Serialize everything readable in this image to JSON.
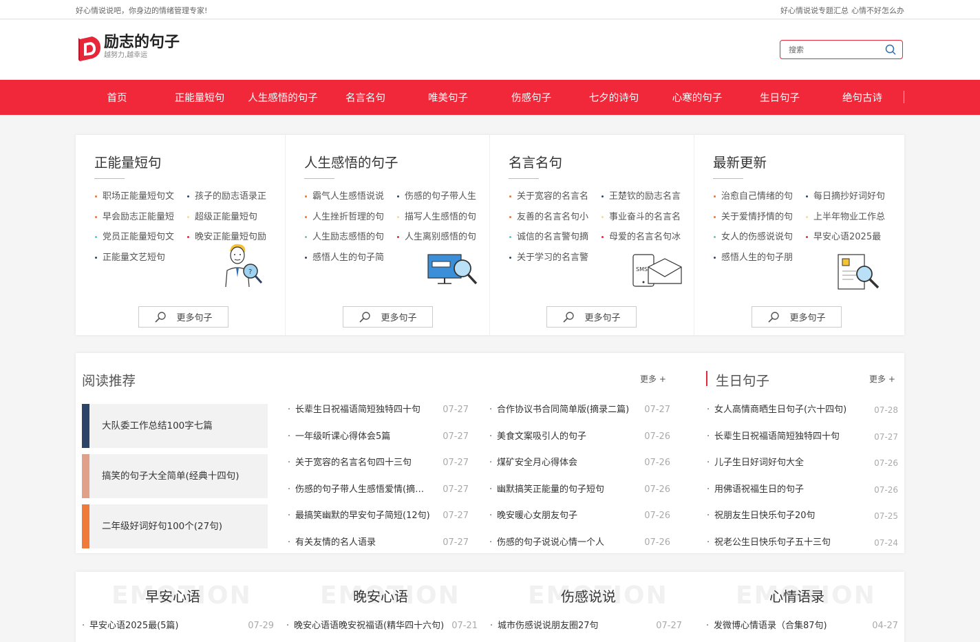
{
  "topbar": {
    "left": "好心情说说吧，你身边的情绪管理专家!",
    "right_links": [
      "好心情说说专题汇总",
      "心情不好怎么办"
    ]
  },
  "logo": {
    "title": "励志的句子",
    "subtitle": "越努力,越幸运"
  },
  "search": {
    "placeholder": "搜索"
  },
  "nav": [
    "首页",
    "正能量短句",
    "人生感悟的句子",
    "名言名句",
    "唯美句子",
    "伤感句子",
    "七夕的诗句",
    "心寒的句子",
    "生日句子",
    "绝句古诗"
  ],
  "categories": [
    {
      "title": "正能量短句",
      "more": "更多句子",
      "items": [
        "职场正能量短句文",
        "孩子的励志语录正",
        "早会励志正能量短",
        "超级正能量短句",
        "党员正能量短句文",
        "晚安正能量短句励",
        "正能量文艺短句"
      ]
    },
    {
      "title": "人生感悟的句子",
      "more": "更多句子",
      "items": [
        "霸气人生感悟说说",
        "伤感的句子带人生",
        "人生挫折哲理的句",
        "描写人生感悟的句",
        "人生励志感悟的句",
        "人生离别感悟的句",
        "感悟人生的句子简"
      ]
    },
    {
      "title": "名言名句",
      "more": "更多句子",
      "items": [
        "关于宽容的名言名",
        "王楚钦的励志名言",
        "友善的名言名句小",
        "事业奋斗的名言名",
        "诚信的名言警句摘",
        "母爱的名言名句冰",
        "关于学习的名言警"
      ]
    },
    {
      "title": "最新更新",
      "more": "更多句子",
      "items": [
        "治愈自己情绪的句",
        "每日摘抄好词好句",
        "关于爱情抒情的句",
        "上半年物业工作总",
        "女人的伤感说说句",
        "早安心语2025最",
        "感悟人生的句子朋"
      ]
    }
  ],
  "reading": {
    "title": "阅读推荐",
    "more": "更多 +",
    "featured": [
      "大队委工作总结100字七篇",
      "搞笑的句子大全简单(经典十四句)",
      "二年级好词好句100个(27句)"
    ],
    "list1": [
      {
        "t": "长辈生日祝福语简短独特四十句",
        "d": "07-27"
      },
      {
        "t": "一年级听课心得体会5篇",
        "d": "07-27"
      },
      {
        "t": "关于宽容的名言名句四十三句",
        "d": "07-27"
      },
      {
        "t": "伤感的句子带人生感悟爱情(摘录三十八句)",
        "d": "07-27"
      },
      {
        "t": "最搞笑幽默的早安句子简短(12句)",
        "d": "07-27"
      },
      {
        "t": "有关友情的名人语录",
        "d": "07-27"
      }
    ],
    "list2": [
      {
        "t": "合作协议书合同简单版(摘录二篇)",
        "d": "07-27"
      },
      {
        "t": "美食文案吸引人的句子",
        "d": "07-26"
      },
      {
        "t": "煤矿安全月心得体会",
        "d": "07-26"
      },
      {
        "t": "幽默搞笑正能量的句子短句",
        "d": "07-26"
      },
      {
        "t": "晚安暖心女朋友句子",
        "d": "07-26"
      },
      {
        "t": "伤感的句子说说心情一个人",
        "d": "07-26"
      }
    ]
  },
  "birthday": {
    "title": "生日句子",
    "more": "更多 +",
    "list": [
      {
        "t": "女人高情商晒生日句子(六十四句)",
        "d": "07-28"
      },
      {
        "t": "长辈生日祝福语简短独特四十句",
        "d": "07-27"
      },
      {
        "t": "儿子生日好词好句大全",
        "d": "07-26"
      },
      {
        "t": "用佛语祝福生日的句子",
        "d": "07-26"
      },
      {
        "t": "祝朋友生日快乐句子20句",
        "d": "07-25"
      },
      {
        "t": "祝老公生日快乐句子五十三句",
        "d": "07-24"
      }
    ]
  },
  "bottom": [
    {
      "wm": "EMOTION",
      "title": "早安心语",
      "item": "早安心语2025最(5篇)",
      "date": "07-29"
    },
    {
      "wm": "EMOTION",
      "title": "晚安心语",
      "item": "晚安心语语晚安祝福语(精华四十六句)",
      "date": "07-21"
    },
    {
      "wm": "EMOTION",
      "title": "伤感说说",
      "item": "城市伤感说说朋友圈27句",
      "date": "07-27"
    },
    {
      "wm": "EMOTION",
      "title": "心情语录",
      "item": "发微博心情语录（合集87句)",
      "date": "04-27"
    }
  ],
  "colors": {
    "brand": "#f0283a",
    "feat1": "#2b4468",
    "feat2": "#e0a08a",
    "feat3": "#f07a3a"
  }
}
